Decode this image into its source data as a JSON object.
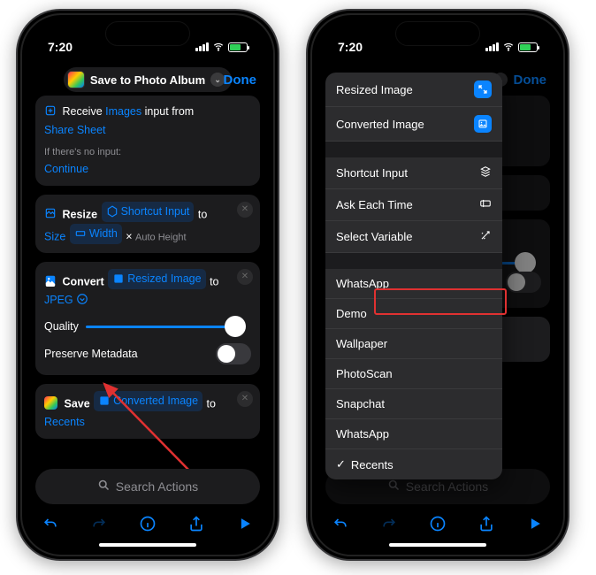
{
  "status": {
    "time": "7:20"
  },
  "nav": {
    "title": "Save to Photo Album",
    "done": "Done"
  },
  "receive": {
    "receive": "Receive",
    "images": "Images",
    "input_from": "input from",
    "share_sheet": "Share Sheet",
    "no_input_label": "If there's no input:",
    "continue": "Continue"
  },
  "resize": {
    "label": "Resize",
    "var": "Shortcut Input",
    "to": "to",
    "size": "Size",
    "width": "Width",
    "x": "×",
    "auto": "Auto Height"
  },
  "convert": {
    "label": "Convert",
    "var": "Resized Image",
    "to": "to",
    "format": "JPEG",
    "quality": "Quality",
    "preserve": "Preserve Metadata"
  },
  "save": {
    "label": "Save",
    "var": "Converted Image",
    "to": "to",
    "album": "Recents"
  },
  "search": {
    "placeholder": "Search Actions"
  },
  "popover": {
    "resized": "Resized Image",
    "converted": "Converted Image",
    "shortcut_input": "Shortcut Input",
    "ask": "Ask Each Time",
    "select_var": "Select Variable",
    "albums": [
      "WhatsApp",
      "Demo",
      "Wallpaper",
      "PhotoScan",
      "Snapchat",
      "WhatsApp"
    ],
    "recents": "Recents"
  }
}
